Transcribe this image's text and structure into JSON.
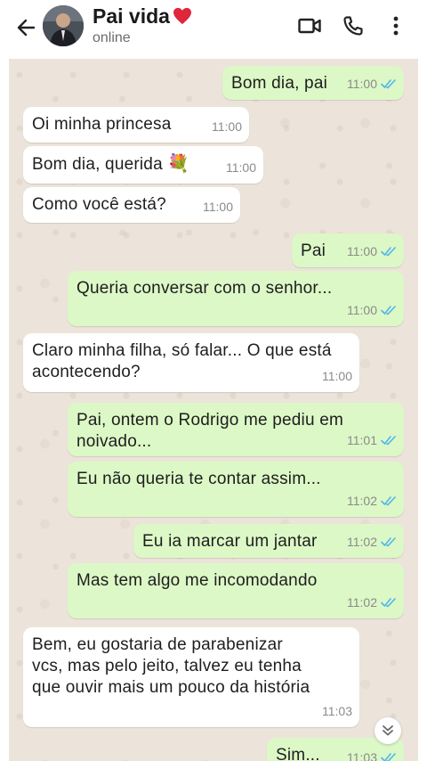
{
  "header": {
    "contact_name": "Pai vida",
    "status": "online",
    "icons": [
      "back-arrow-icon",
      "video-call-icon",
      "phone-call-icon",
      "more-options-icon"
    ],
    "heart_color": "#e0263a"
  },
  "messages": [
    {
      "dir": "out",
      "text": "Bom dia, pai",
      "time": "11:00"
    },
    {
      "dir": "in",
      "text": "Oi minha princesa",
      "time": "11:00"
    },
    {
      "dir": "in",
      "text": "Bom dia, querida",
      "emoji": "💐",
      "time": "11:00"
    },
    {
      "dir": "in",
      "text": "Como você está?",
      "time": "11:00"
    },
    {
      "dir": "out",
      "text": "Pai",
      "time": "11:00"
    },
    {
      "dir": "out",
      "text": "Queria conversar com o senhor...",
      "time": "11:00"
    },
    {
      "dir": "in",
      "text": "Claro minha filha, só falar... O que está\nacontecendo?",
      "time": "11:00"
    },
    {
      "dir": "out",
      "text": "Pai, ontem o Rodrigo me pediu em\nnoivado...",
      "time": "11:01"
    },
    {
      "dir": "out",
      "text": "Eu não queria te contar assim...",
      "time": "11:02"
    },
    {
      "dir": "out",
      "text": "Eu ia marcar um jantar",
      "time": "11:02"
    },
    {
      "dir": "out",
      "text": "Mas tem algo me incomodando",
      "time": "11:02"
    },
    {
      "dir": "in",
      "text": "Bem, eu gostaria de parabenizar\nvcs, mas pelo jeito, talvez eu tenha\nque ouvir mais um pouco da história",
      "time": "11:03"
    },
    {
      "dir": "out",
      "text": "Sim...",
      "time": "11:03"
    }
  ],
  "colors": {
    "outgoing_bubble": "#dcf8c6",
    "incoming_bubble": "#ffffff",
    "read_ticks": "#4fb6ec",
    "chat_background": "#ece4da"
  }
}
